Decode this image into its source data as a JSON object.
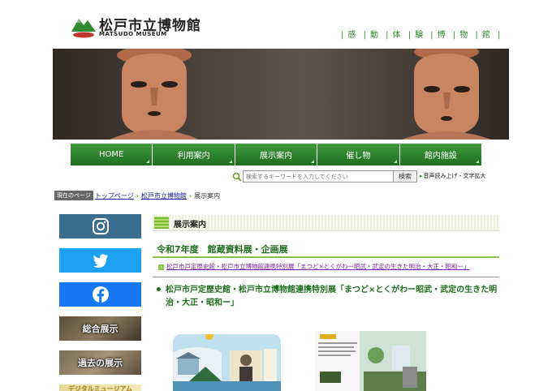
{
  "header": {
    "logo_title": "松戸市立博物館",
    "logo_sub": "MATSUDO MUSEUM",
    "nav_links": [
      "感",
      "動",
      "体",
      "験",
      "博",
      "物",
      "館"
    ]
  },
  "main_nav": [
    "HOME",
    "利用案内",
    "展示案内",
    "催し物",
    "館内施設"
  ],
  "search": {
    "placeholder": "検索するキーワードを入力してください",
    "button": "検索",
    "reading": "音声読み上げ・文字拡大"
  },
  "breadcrumb": {
    "label": "現在のページ",
    "items": [
      "トップページ",
      "松戸市立博物館",
      "展示案内"
    ]
  },
  "sidebar": {
    "sns": [
      "instagram-icon",
      "twitter-icon",
      "facebook-icon"
    ],
    "banners": [
      "総合展示",
      "過去の展示",
      "デジタルミュージアム"
    ]
  },
  "content": {
    "section_title": "展示案内",
    "heading": "令和7年度　館蔵資料展・企画展",
    "link": "松戸市戸定歴史館・松戸市立博物館連携特別展「まつど×とくがわー昭武・武定の生きた明治・大正・昭和ー」",
    "exhibit_title": "松戸市戸定歴史館・松戸市立博物館連携特別展「まつど×とくがわー昭武・武定の生きた明治・大正・昭和ー」"
  },
  "colors": {
    "accent_green": "#2f8c2f",
    "nav_green": "#1f6d1f",
    "link_purple": "#7a1fa2"
  }
}
